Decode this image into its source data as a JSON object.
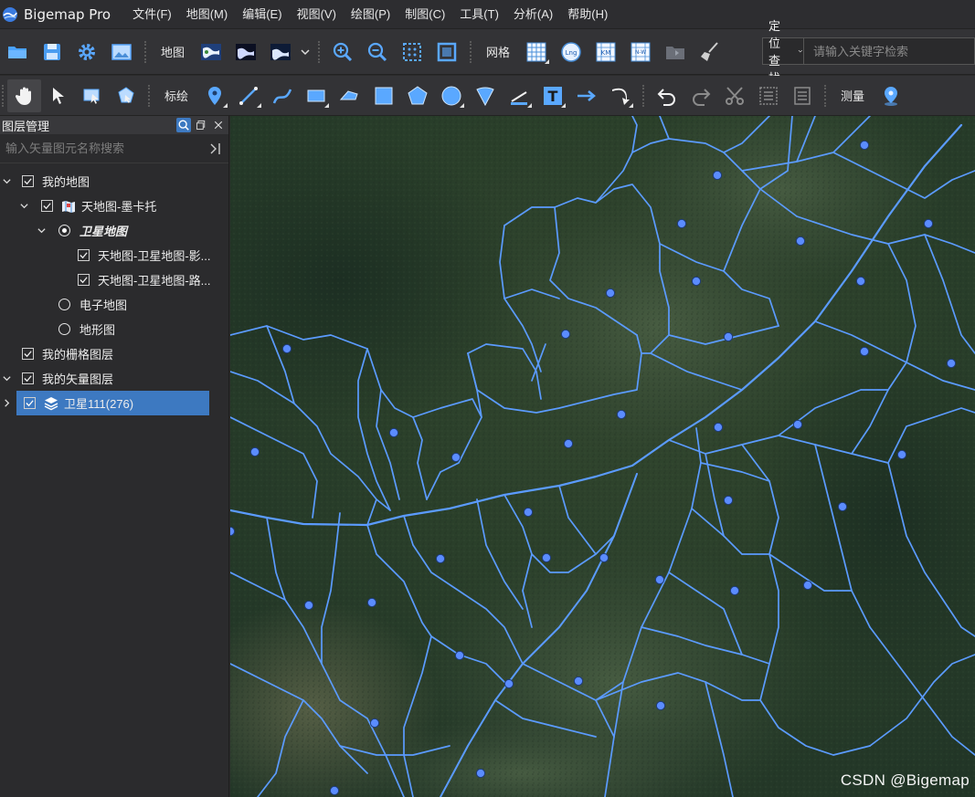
{
  "app": {
    "title": "Bigemap Pro"
  },
  "menu": [
    "文件(F)",
    "地图(M)",
    "编辑(E)",
    "视图(V)",
    "绘图(P)",
    "制图(C)",
    "工具(T)",
    "分析(A)",
    "帮助(H)"
  ],
  "toolbar1": {
    "map_label": "地图",
    "grid_label": "网格",
    "locate_select": "定位查找",
    "search_placeholder": "请输入关键字检索",
    "grid_km": "KM",
    "grid_nw": "N-W",
    "grid_lng": "Lng"
  },
  "toolbar2": {
    "draw_label": "标绘",
    "text_tool": "T",
    "measure_label": "测量"
  },
  "sidebar": {
    "title": "图层管理",
    "filter_placeholder": "输入矢量图元名称搜索",
    "tree": {
      "my_map": "我的地图",
      "tianditu": "天地图-墨卡托",
      "satellite": "卫星地图",
      "sat_image": "天地图-卫星地图-影...",
      "sat_road": "天地图-卫星地图-路...",
      "electronic": "电子地图",
      "terrain": "地形图",
      "raster_layers": "我的栅格图层",
      "vector_layers": "我的矢量图层",
      "vector_item": "卫星111(276)"
    }
  },
  "map": {
    "watermark": "CSDN @Bigemap",
    "point_color": "#5b8cff",
    "line_color": "#5b9bff"
  },
  "colors": {
    "accent": "#3d79c1",
    "bg_dark": "#2b2b2d"
  }
}
